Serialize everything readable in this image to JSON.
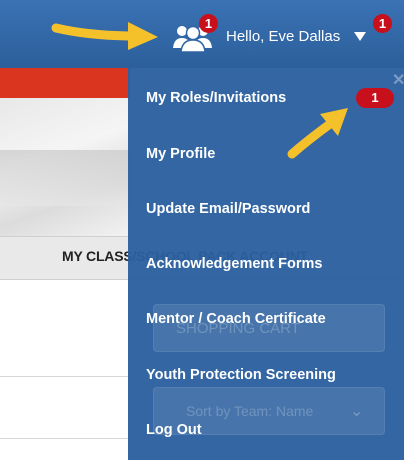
{
  "header": {
    "greeting": "Hello, Eve Dallas",
    "icon_badge_count": "1",
    "greeting_badge_count": "1"
  },
  "page": {
    "tab_label": "MY CLASS/SCHOOL PACK ACCOUNT",
    "cart_button": "SHOPPING CART",
    "sort_select": "Sort by Team: Name"
  },
  "menu": {
    "items": [
      {
        "label": "My Roles/Invitations",
        "badge": "1"
      },
      {
        "label": "My Profile"
      },
      {
        "label": "Update Email/Password"
      },
      {
        "label": "Acknowledgement Forms"
      },
      {
        "label": "Mentor / Coach Certificate"
      },
      {
        "label": "Youth Protection Screening"
      },
      {
        "label": "Log Out"
      }
    ]
  },
  "colors": {
    "header_blue": "#2f66a6",
    "menu_blue": "#2b609e",
    "badge_red": "#c8101d",
    "arrow_yellow": "#f5c12a",
    "accent_red": "#d9351f"
  },
  "icons": {
    "users": "users-icon",
    "caret": "caret-down-icon",
    "arrow": "arrow-icon"
  }
}
